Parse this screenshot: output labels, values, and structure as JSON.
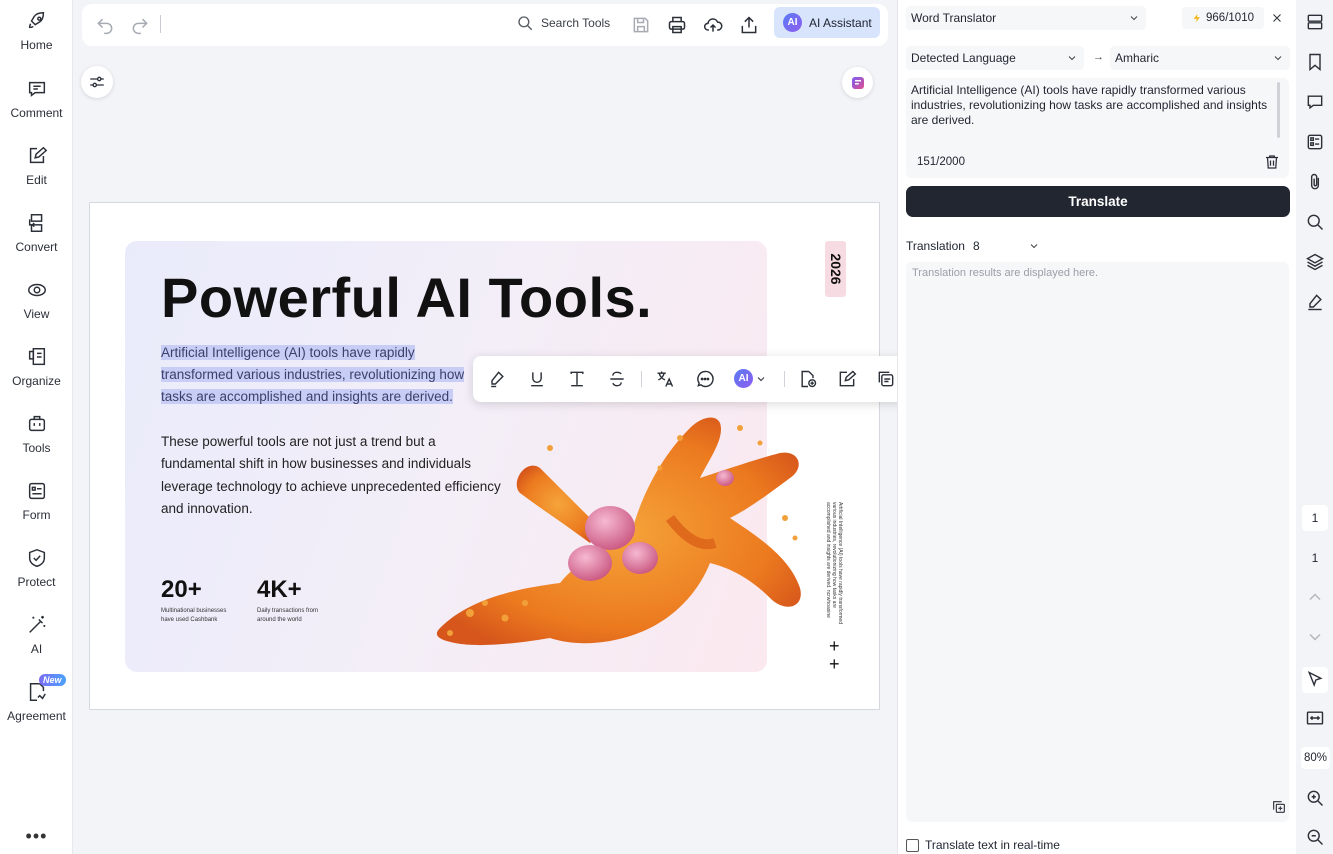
{
  "sidebar": {
    "items": [
      {
        "label": "Home",
        "icon": "rocket-icon"
      },
      {
        "label": "Comment",
        "icon": "comment-icon"
      },
      {
        "label": "Edit",
        "icon": "edit-icon"
      },
      {
        "label": "Convert",
        "icon": "convert-icon"
      },
      {
        "label": "View",
        "icon": "eye-icon"
      },
      {
        "label": "Organize",
        "icon": "organize-icon"
      },
      {
        "label": "Tools",
        "icon": "toolbox-icon"
      },
      {
        "label": "Form",
        "icon": "form-icon"
      },
      {
        "label": "Protect",
        "icon": "shield-icon"
      },
      {
        "label": "AI",
        "icon": "magic-wand-icon"
      },
      {
        "label": "Agreement",
        "icon": "agreement-icon"
      }
    ],
    "new_badge": "New",
    "more": "•••"
  },
  "toolbar": {
    "search_label": "Search Tools",
    "ai_assistant_label": "AI Assistant",
    "ai_badge": "AI"
  },
  "document": {
    "title": "Powerful AI Tools.",
    "selected_text_lines": [
      "Artificial Intelligence (AI) tools have rapidly",
      "transformed various industries, revolutionizing how",
      "tasks are accomplished and insights are derived."
    ],
    "paragraph": "These powerful tools are not just a trend but a fundamental shift in how businesses and individuals leverage technology to achieve unprecedented efficiency and innovation.",
    "stats": [
      {
        "value": "20+",
        "desc": "Multinational businesses have used Cashbank"
      },
      {
        "value": "4K+",
        "desc": "Daily transactions from around the world"
      }
    ],
    "year": "2026",
    "vertical_note": "Artificial Intelligence (AI) tools have rapidly transformed various industries, revolutionizing how tasks are accomplished and insights are derived. ncrwhoasine",
    "plus_marks": "+\n+"
  },
  "selection_toolbar": {
    "ai_label": "AI"
  },
  "translator": {
    "mode": "Word Translator",
    "credits": "966/1010",
    "source_language": "Detected Language",
    "target_language": "Amharic",
    "arrow": "→",
    "source_text": "Artificial Intelligence (AI) tools have rapidly transformed various industries, revolutionizing how tasks are accomplished and insights are derived.",
    "char_count": "151/2000",
    "translate_button": "Translate",
    "translation_label": "Translation",
    "translation_option": "8",
    "placeholder": "Translation results are displayed here.",
    "realtime_label": "Translate text in real-time",
    "realtime_checked": false
  },
  "right_rail": {
    "current_page": "1",
    "total_pages": "1",
    "zoom": "80%"
  },
  "colors": {
    "accent": "#222631",
    "highlight": "#c7cdf5",
    "ai_assistant_bg": "#d7e4fb"
  }
}
